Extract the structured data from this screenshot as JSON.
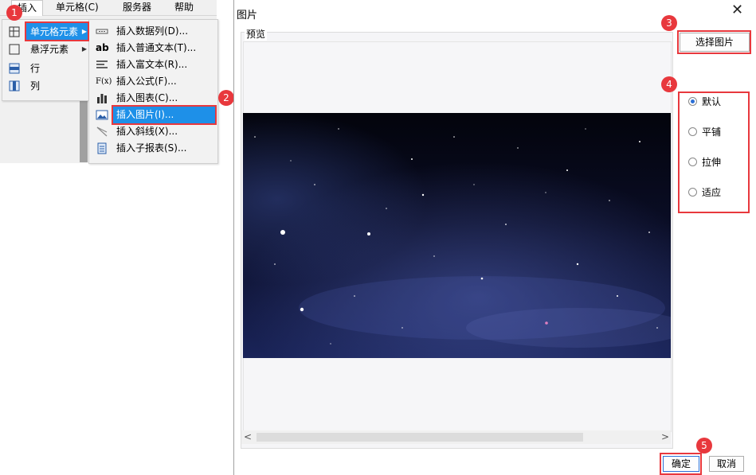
{
  "menubar": {
    "items": [
      {
        "label": "插入"
      },
      {
        "label": "单元格(C)"
      },
      {
        "label": "服务器"
      },
      {
        "label": "帮助"
      }
    ]
  },
  "insert_menu": {
    "items": [
      {
        "label": "单元格元素",
        "icon": "cell-grid-icon"
      },
      {
        "label": "悬浮元素",
        "icon": "float-box-icon"
      },
      {
        "label": "行",
        "icon": "row-icon"
      },
      {
        "label": "列",
        "icon": "column-icon"
      }
    ]
  },
  "cell_element_menu": {
    "items": [
      {
        "label": "插入数据列(D)...",
        "icon": "data-column-icon"
      },
      {
        "label": "插入普通文本(T)...",
        "icon_text": "ab"
      },
      {
        "label": "插入富文本(R)...",
        "icon": "rich-text-icon"
      },
      {
        "label": "插入公式(F)...",
        "icon_text": "F(x)"
      },
      {
        "label": "插入图表(C)...",
        "icon": "chart-icon"
      },
      {
        "label": "插入图片(I)...",
        "icon": "image-icon"
      },
      {
        "label": "插入斜线(X)...",
        "icon": "slash-icon"
      },
      {
        "label": "插入子报表(S)...",
        "icon": "subreport-icon"
      }
    ]
  },
  "dialog": {
    "title": "图片",
    "preview_label": "预览",
    "choose_button": "选择图片",
    "modes": [
      {
        "label": "默认",
        "selected": true
      },
      {
        "label": "平铺",
        "selected": false
      },
      {
        "label": "拉伸",
        "selected": false
      },
      {
        "label": "适应",
        "selected": false
      }
    ],
    "ok": "确定",
    "cancel": "取消"
  },
  "badges": [
    "1",
    "2",
    "3",
    "4",
    "5"
  ],
  "colors": {
    "highlight": "#1e90e8",
    "annotation": "#e8383d"
  }
}
